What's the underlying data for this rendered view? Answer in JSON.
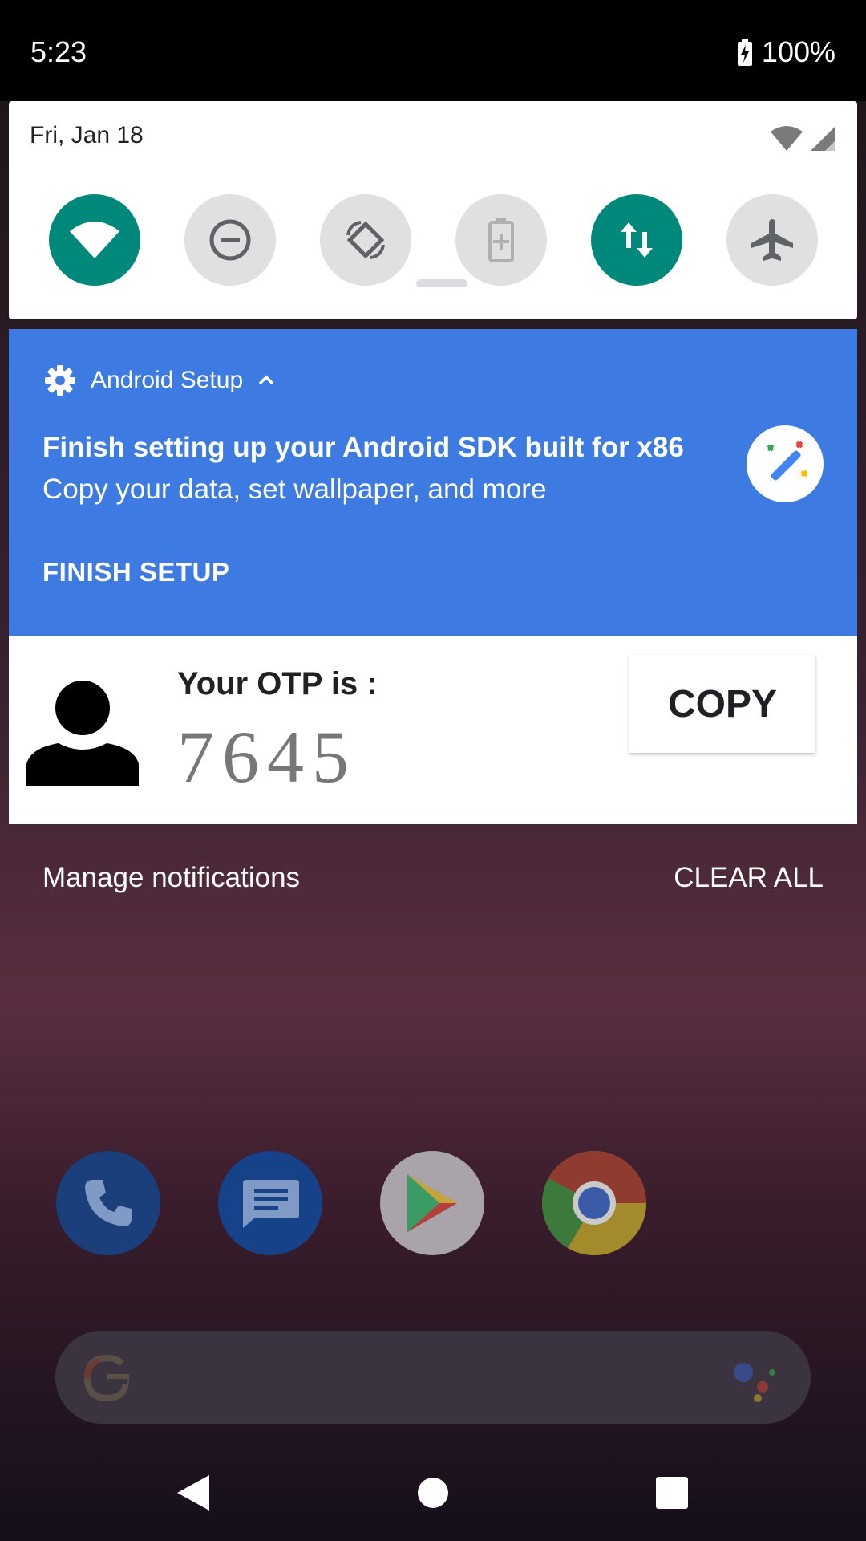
{
  "status_bar": {
    "time": "5:23",
    "battery_pct": "100%"
  },
  "quick_settings": {
    "date": "Fri, Jan 18",
    "tiles": [
      {
        "name": "wifi",
        "state": "on"
      },
      {
        "name": "do-not-disturb",
        "state": "off"
      },
      {
        "name": "auto-rotate",
        "state": "off"
      },
      {
        "name": "battery-saver",
        "state": "off"
      },
      {
        "name": "mobile-data",
        "state": "on"
      },
      {
        "name": "airplane-mode",
        "state": "off"
      }
    ]
  },
  "setup_notification": {
    "app_name": "Android Setup",
    "title": "Finish setting up your Android SDK built for x86",
    "text": "Copy your data, set wallpaper, and more",
    "action": "FINISH SETUP"
  },
  "otp_notification": {
    "label": "Your OTP is :",
    "code": "7645",
    "copy_label": "COPY"
  },
  "footer": {
    "manage_label": "Manage notifications",
    "clear_label": "CLEAR ALL"
  },
  "colors": {
    "tile_on": "#00897b",
    "setup_card": "#3d7be3"
  }
}
